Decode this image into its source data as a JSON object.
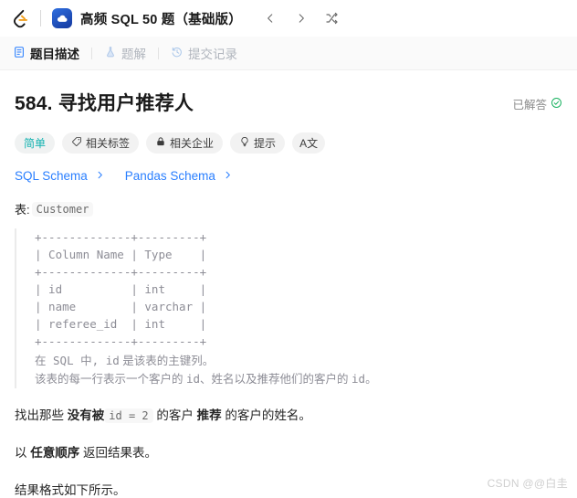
{
  "topbar": {
    "logo_icon": "leetcode-logo-icon",
    "study_plan_icon": "study-plan-cloud-icon",
    "study_plan_title": "高频 SQL 50 题（基础版）",
    "prev_label": "chevron-left-icon",
    "next_label": "chevron-right-icon",
    "shuffle_label": "shuffle-icon"
  },
  "tabs": [
    {
      "label": "题目描述",
      "icon": "document-icon",
      "active": true
    },
    {
      "label": "题解",
      "icon": "flask-icon",
      "active": false
    },
    {
      "label": "提交记录",
      "icon": "history-clock-icon",
      "active": false
    }
  ],
  "problem": {
    "number": "584.",
    "title": "寻找用户推荐人",
    "full_title": "584. 寻找用户推荐人",
    "solved_label": "已解答",
    "solved_icon": "check-circle-icon",
    "accent_solved": "#17b15e"
  },
  "tags": [
    {
      "label": "简单",
      "icon": null,
      "kind": "difficulty"
    },
    {
      "label": "相关标签",
      "icon": "tag-icon",
      "kind": "normal"
    },
    {
      "label": "相关企业",
      "icon": "lock-icon",
      "kind": "normal"
    },
    {
      "label": "提示",
      "icon": "lightbulb-icon",
      "kind": "normal"
    },
    {
      "label": "A文",
      "icon": "language-toggle-icon",
      "kind": "icon-only"
    }
  ],
  "schema_links": [
    {
      "label": "SQL Schema",
      "icon": "chevron-right-icon"
    },
    {
      "label": "Pandas Schema",
      "icon": "chevron-right-icon"
    }
  ],
  "table_intro": {
    "prefix": "表:",
    "table_name": "Customer"
  },
  "schema_block": {
    "ascii": "+-------------+---------+\n| Column Name | Type    |\n+-------------+---------+\n| id          | int     |\n| name        | varchar |\n| referee_id  | int     |\n+-------------+---------+",
    "note_line_1_a": "在 SQL 中, ",
    "note_line_1_mono": "id",
    "note_line_1_b": " 是该表的主键列。",
    "note_line_2_a": "该表的每一行表示一个客户的 ",
    "note_line_2_mono_1": "id",
    "note_line_2_b": "、姓名以及推荐他们的客户的 ",
    "note_line_2_mono_2": "id",
    "note_line_2_c": "。"
  },
  "body": {
    "p1_a": "找出那些 ",
    "p1_bold_1": "没有被",
    "p1_code": "id = 2",
    "p1_b": " 的客户 ",
    "p1_bold_2": "推荐",
    "p1_c": " 的客户的姓名。",
    "p2_a": "以 ",
    "p2_bold": "任意顺序",
    "p2_b": " 返回结果表。",
    "p3": "结果格式如下所示。"
  },
  "watermark": {
    "text": "CSDN @@白圭"
  },
  "colors": {
    "link": "#2a7fff",
    "difficulty_teal": "#12b2b0",
    "mono_gray": "#8d8d96",
    "solved_green": "#17b15e"
  }
}
